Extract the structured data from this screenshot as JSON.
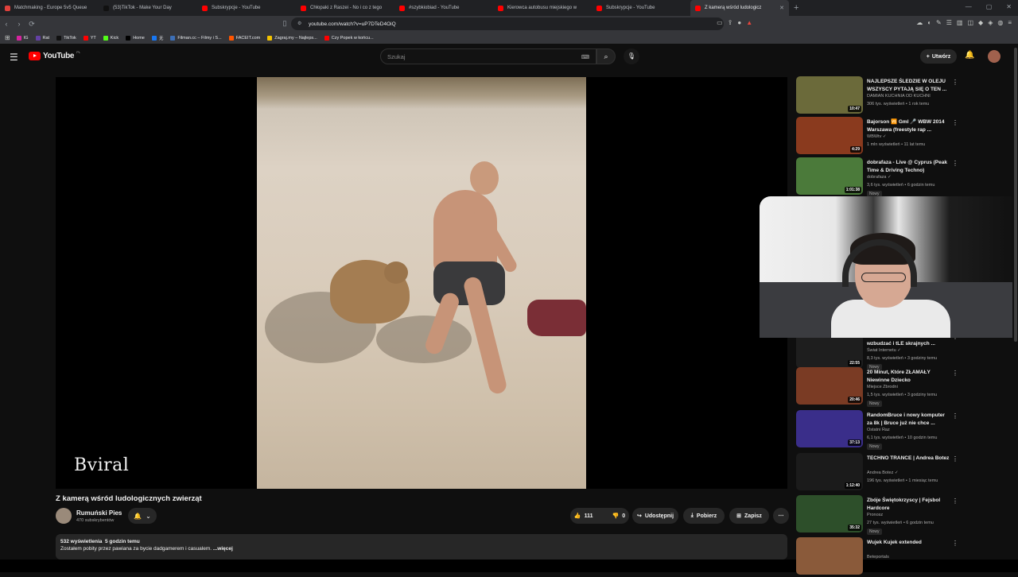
{
  "browser": {
    "tabs": [
      {
        "title": "Matchmaking - Europe 5v5 Queue",
        "color": "#e0413c"
      },
      {
        "title": "(53)TikTok - Make Your Day",
        "color": "#111111"
      },
      {
        "title": "Subskrypcje - YouTube",
        "color": "#ff0000"
      },
      {
        "title": "Chłopaki z Raszei - No i co z tego",
        "color": "#ff0000"
      },
      {
        "title": "#szybkiobiad - YouTube",
        "color": "#ff0000"
      },
      {
        "title": "Kierowca autobusu miejskiego w",
        "color": "#ff0000"
      },
      {
        "title": "Subskrypcje - YouTube",
        "color": "#ff0000"
      },
      {
        "title": "Z kamerą wśród ludologicz",
        "color": "#ff0000",
        "active": true
      }
    ],
    "url": "youtube.com/watch?v=uP7DTeD4OiQ",
    "bookmarks": [
      {
        "label": "IG",
        "color": "#d6249f"
      },
      {
        "label": "Rat",
        "color": "#6441a5"
      },
      {
        "label": "TikTok",
        "color": "#111111"
      },
      {
        "label": "YT",
        "color": "#ff0000"
      },
      {
        "label": "Kick",
        "color": "#53fc18"
      },
      {
        "label": "Home",
        "color": "#000000"
      },
      {
        "label": "无",
        "color": "#1877f2"
      },
      {
        "label": "Filman.cc – Filmy i S...",
        "color": "#3d6fb6"
      },
      {
        "label": "FACEIT.com",
        "color": "#ff5500"
      },
      {
        "label": "Zagraj.my – Najleps...",
        "color": "#f2c200"
      },
      {
        "label": "Czy Popek w końcu...",
        "color": "#ff0000"
      }
    ]
  },
  "header": {
    "logo_text": "YouTube",
    "logo_country": "PL",
    "search_placeholder": "Szukaj",
    "create_label": "Utwórz"
  },
  "video": {
    "watermark": "Bviral",
    "title": "Z kamerą wśród ludologicznych zwierząt",
    "channel_name": "Rumuński Pies",
    "channel_subs": "470 subskrybentów",
    "likes": "111",
    "dislikes": "0",
    "share_label": "Udostępnij",
    "download_label": "Pobierz",
    "save_label": "Zapisz",
    "views": "532 wyświetlenia",
    "age": "5 godzin temu",
    "description": "Zostałem pobity przez pawiana za bycie dadgamerem i casualem.",
    "more_label": "...więcej"
  },
  "recommendations": [
    {
      "title": "NAJLEPSZE ŚLEDZIE W OLEJU WSZYSCY PYTAJĄ SIĘ O TEN ...",
      "channel": "DAMIAN KUCHNIA OD KUCHNI",
      "meta": "306 tys. wyświetleń • 1 rok temu",
      "duration": "10:47",
      "badge": "",
      "thumb_color": "#6b6a3a"
    },
    {
      "title": "Bajorson 🆚 Gml 🎤 WBW 2014 Warszawa (freestyle rap ...",
      "channel": "WBWtv ✓",
      "meta": "1 mln wyświetleń • 11 lat temu",
      "duration": "4:29",
      "badge": "",
      "thumb_color": "#8a3a1e"
    },
    {
      "title": "dobrafaza - Live @ Cyprus (Peak Time & Driving Techno)",
      "channel": "dobrafaza ✓",
      "meta": "3,6 tys. wyświetleń • 6 godzin temu",
      "duration": "1:01:38",
      "badge": "Nowy",
      "thumb_color": "#4b7a3a"
    },
    {
      "title": "WSZYSTKO DLA KLIKÓW – wzbudzać i tLE skrajnych ...",
      "channel": "Świat Internetu ✓",
      "meta": "8,3 tys. wyświetleń • 3 godziny temu",
      "duration": "22:55",
      "badge": "Nowy",
      "thumb_color": "#1e1e1e"
    },
    {
      "title": "20 Minut, Które ZŁAMAŁY Niewinne Dziecko",
      "channel": "Miejsce Zbrodni",
      "meta": "1,5 tys. wyświetleń • 3 godziny temu",
      "duration": "20:46",
      "badge": "Nowy",
      "thumb_color": "#7a3b24"
    },
    {
      "title": "RandomBruce i nowy komputer za 8k | Bruce już nie chce ...",
      "channel": "Ostatni Raz",
      "meta": "6,1 tys. wyświetleń • 10 godzin temu",
      "duration": "37:13",
      "badge": "Nowy",
      "thumb_color": "#3a2e8a"
    },
    {
      "title": "TECHNO TRANCE | Andrea Botez",
      "channel": "Andrea Botez ✓",
      "meta": "196 tys. wyświetleń • 1 miesiąc temu",
      "duration": "1:12:40",
      "badge": "",
      "thumb_color": "#1b1b1b"
    },
    {
      "title": "Zbóje Świętokrzyscy | Fejsbol Hardcore",
      "channel": "Pronosz",
      "meta": "27 tys. wyświetleń • 6 godzin temu",
      "duration": "35:32",
      "badge": "Nowy",
      "thumb_color": "#2d4f2a"
    },
    {
      "title": "Wujek Kujek extended",
      "channel": "Beteportals",
      "meta": "",
      "duration": "",
      "badge": "",
      "thumb_color": "#8a5a3a"
    }
  ]
}
